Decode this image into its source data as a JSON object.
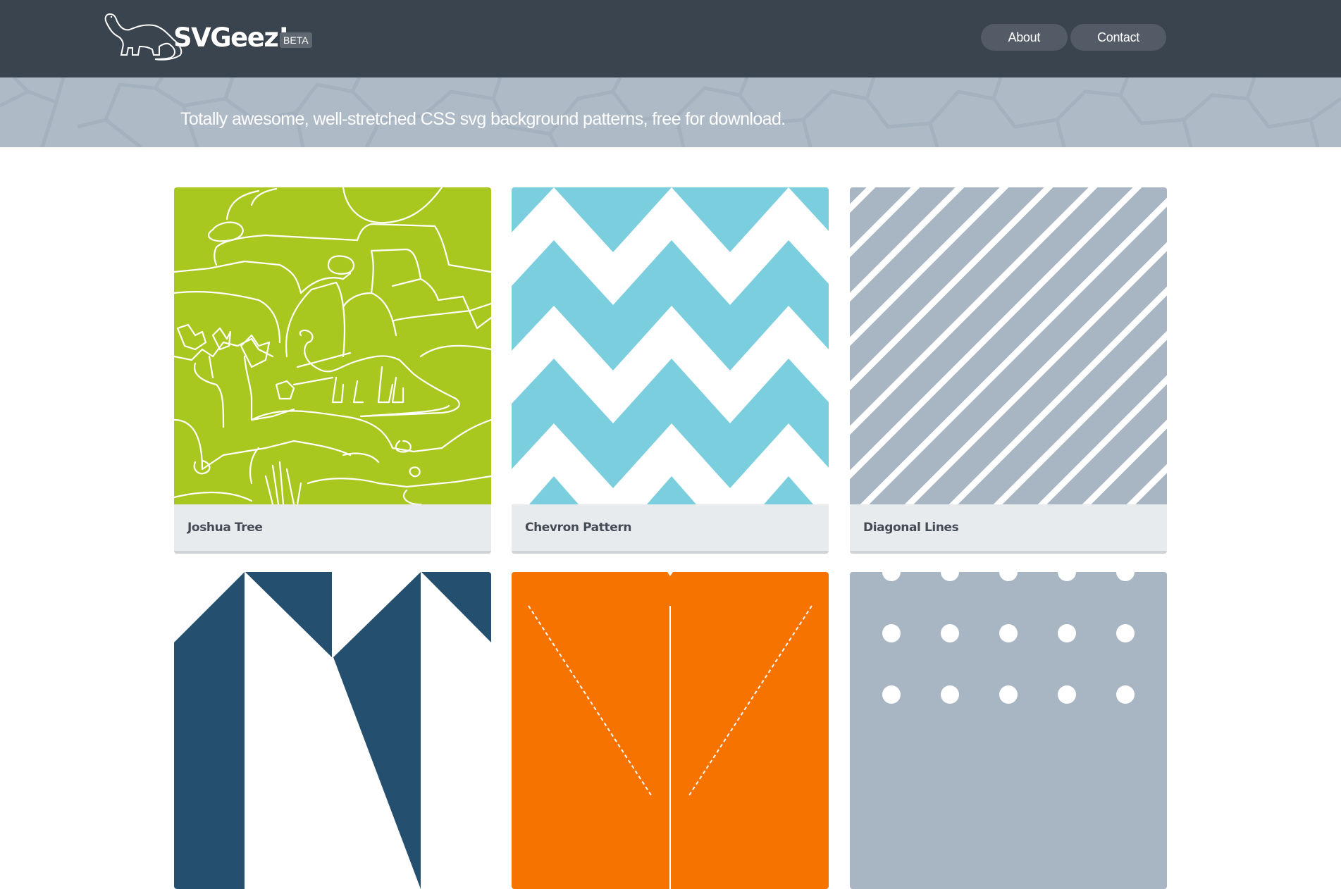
{
  "header": {
    "logo_text": "SVGeez!",
    "logo_badge": "BETA",
    "logo_icon": "dinosaur-icon",
    "nav": [
      {
        "label": "About"
      },
      {
        "label": "Contact"
      }
    ],
    "colors": {
      "bar": "#3a444f",
      "nav_button": "#535c66"
    }
  },
  "hero": {
    "tagline": "Totally awesome, well-stretched CSS svg background patterns, free for download.",
    "background_color": "#aebac6",
    "pattern": "stone-pattern"
  },
  "patterns": [
    {
      "title": "Joshua Tree",
      "color": "#a8c81f",
      "pattern": "joshua-tree-dinosaur"
    },
    {
      "title": "Chevron Pattern",
      "color": "#7acedd",
      "pattern": "chevron"
    },
    {
      "title": "Diagonal Lines",
      "color": "#a8b5c2",
      "pattern": "diagonal-lines"
    },
    {
      "title": "",
      "color": "#244f6e",
      "pattern": "triangles"
    },
    {
      "title": "",
      "color": "#f77300",
      "pattern": "dashed-rays"
    },
    {
      "title": "",
      "color": "#a8b5c2",
      "pattern": "polka-dots"
    }
  ]
}
